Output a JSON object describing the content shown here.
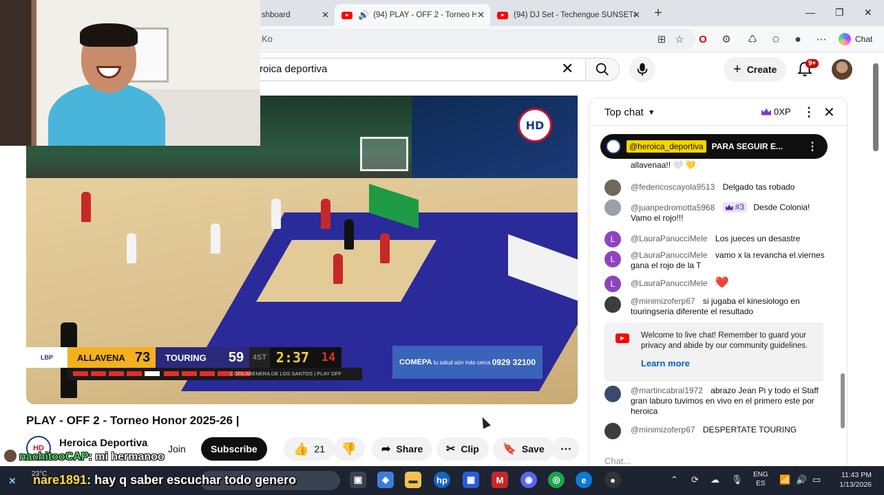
{
  "browser": {
    "tabs": [
      {
        "label": "shboard"
      },
      {
        "label": "(94) PLAY - OFF 2 - Torneo Ho"
      },
      {
        "label": "(94) DJ Set - Techengue SUNSET#"
      }
    ],
    "url_fragment": "Ko",
    "chat_label": "Chat"
  },
  "youtube": {
    "search_value": "roica deportiva",
    "create_label": "Create",
    "notif_badge": "9+"
  },
  "video": {
    "title": "PLAY - OFF 2 - Torneo Honor 2025-26 |",
    "channel_name": "Heroica Deportiva",
    "channel_subs": "100K subscribers",
    "join_label": "Join",
    "subscribe_label": "Subscribe",
    "like_count": "21",
    "share_label": "Share",
    "clip_label": "Clip",
    "save_label": "Save",
    "broadcast_logo": "HD",
    "scoreboard": {
      "league": "LBP",
      "team1": "ALLAVENA",
      "score1": "73",
      "team2": "TOURING",
      "score2": "59",
      "period": "4ST",
      "clock": "2:37",
      "shot_clock": "14",
      "subtitle": "COPA ARENERA DE LOS SANTOS | PLAY OFF",
      "team1_fouls": 5,
      "team2_fouls": 5
    },
    "sponsor": {
      "name": "COMEPA",
      "tagline": "tu salud aún más cerca",
      "phone": "0929 32100"
    }
  },
  "chat": {
    "title": "Top chat",
    "xp": "0XP",
    "pinned": {
      "author": "@heroica_deportiva",
      "text": "PARA SEGUIR E..."
    },
    "partial_text": "allavenaa!! 🤍 💛",
    "messages": [
      {
        "author": "@federicoscayola9513",
        "text": "Delgado tas robado"
      },
      {
        "author": "@juanpedromotta5968",
        "rank": "#3",
        "text": "Desde Colonia! Vamo el rojo!!!"
      },
      {
        "author": "@LauraPanucciMele",
        "text": "Los jueces un desastre"
      },
      {
        "author": "@LauraPanucciMele",
        "text": "vamo x la revancha el.viernes gana el rojo de la T"
      },
      {
        "author": "@LauraPanucciMele",
        "text": "❤️"
      },
      {
        "author": "@minimizoferp67",
        "text": "si jugaba el kinesiologo en touringseria diferente el resultado"
      }
    ],
    "notice": {
      "text": "Welcome to live chat! Remember to guard your privacy and abide by our community guidelines.",
      "link": "Learn more"
    },
    "messages_after": [
      {
        "author": "@martincabral1972",
        "text": "abrazo Jean Pi y todo el Staff gran laburo tuvimos en vivo en el primero este por heroica"
      },
      {
        "author": "@minimizoferp67",
        "text": "DESPERTATE TOURING"
      }
    ],
    "input_placeholder": "Chat..."
  },
  "stream_overlay": {
    "line1_user": "nachitooCAP",
    "line1_text": ": mi hermanoo",
    "line2_user": "nare1891",
    "line2_text": ": hay q saber escuchar todo genero"
  },
  "taskbar": {
    "weather_temp": "23°C",
    "lang_top": "ENG",
    "lang_bottom": "ES",
    "time": "11:43 PM",
    "date": "1/13/2026"
  },
  "colors": {
    "youtube_red": "#ff0000",
    "team1_yellow": "#f4b01f",
    "team2_navy": "#2b2a7a",
    "link_blue": "#065fd4"
  }
}
